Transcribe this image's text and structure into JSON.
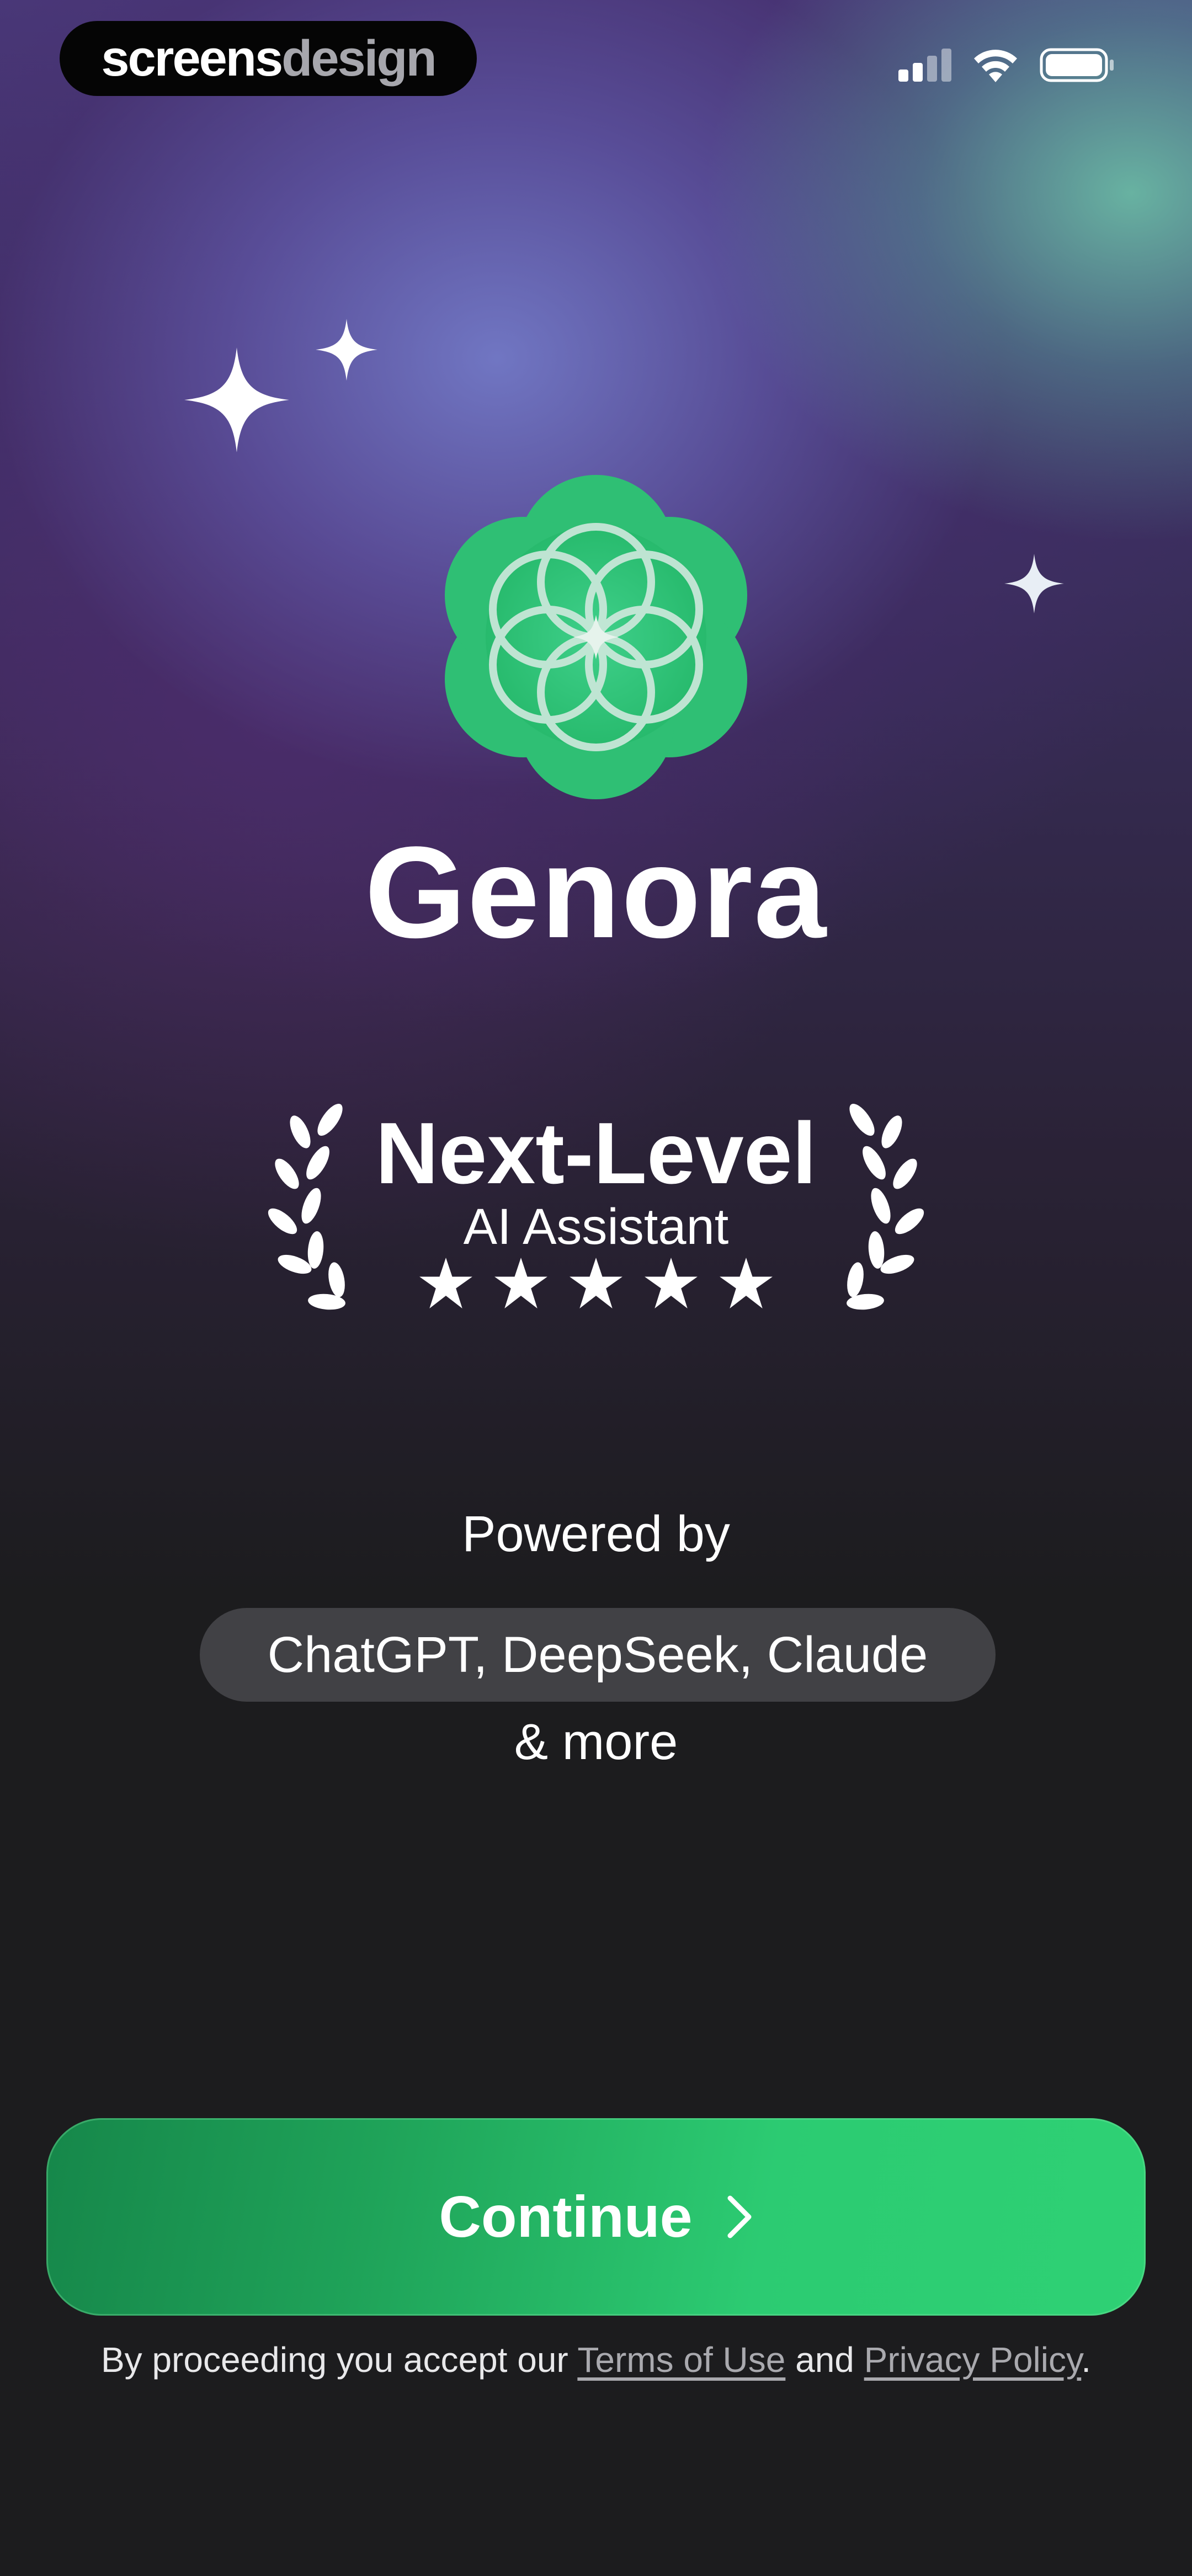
{
  "status_bar": {
    "brand_part1": "screens",
    "brand_part2": "design",
    "icons": [
      "signal-icon",
      "wifi-icon",
      "battery-icon"
    ]
  },
  "app": {
    "name": "Genora"
  },
  "award": {
    "title": "Next-Level",
    "subtitle": "AI Assistant",
    "rating": 5,
    "max_rating": 5
  },
  "powered": {
    "label": "Powered by",
    "models": "ChatGPT, DeepSeek, Claude",
    "more": "& more"
  },
  "cta": {
    "continue_label": "Continue"
  },
  "legal": {
    "prefix": "By proceeding you accept our ",
    "terms": "Terms of Use",
    "middle": " and ",
    "privacy": "Privacy Policy",
    "suffix": "."
  },
  "colors": {
    "accent": "#2ecc71",
    "background": "#1c1c1e",
    "pill": "#414145"
  }
}
